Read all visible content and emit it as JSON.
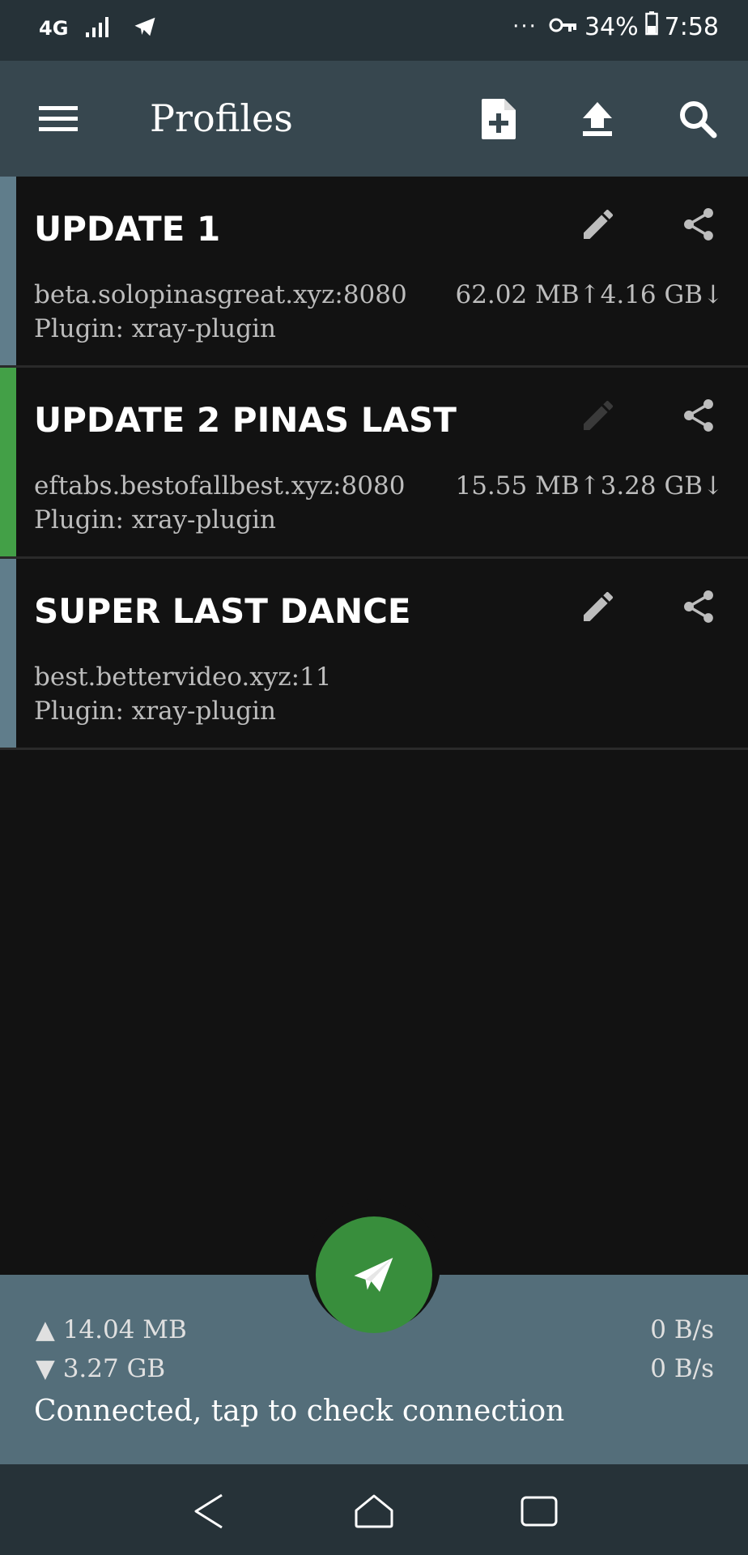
{
  "status_bar": {
    "network": "4G",
    "battery": "34%",
    "time": "7:58",
    "icons": [
      "signal-icon",
      "telegram-icon",
      "vpn-key-icon",
      "battery-icon"
    ]
  },
  "app_bar": {
    "title": "Profiles",
    "actions": [
      "add-profile-icon",
      "upload-icon",
      "search-icon"
    ]
  },
  "profiles": [
    {
      "name": "UPDATE 1",
      "host": "beta.solopinasgreat.xyz:8080",
      "plugin": "Plugin: xray-plugin",
      "upload": "62.02 MB",
      "download": "4.16 GB",
      "selected": false,
      "edit_enabled": true
    },
    {
      "name": "UPDATE 2 PINAS LAST",
      "host": "eftabs.bestofallbest.xyz:8080",
      "plugin": "Plugin: xray-plugin",
      "upload": "15.55 MB",
      "download": "3.28 GB",
      "selected": true,
      "edit_enabled": false
    },
    {
      "name": "SUPER LAST DANCE",
      "host": "best.bettervideo.xyz:11",
      "plugin": "Plugin: xray-plugin",
      "selected": false,
      "edit_enabled": true
    }
  ],
  "stats": {
    "tx_total": "▲ 14.04 MB",
    "rx_total": "▼ 3.27 GB",
    "tx_rate": "0 B/s",
    "rx_rate": "0 B/s",
    "status": "Connected, tap to check connection"
  },
  "colors": {
    "accent_selected": "#43a047",
    "accent_default": "#607d8b",
    "appbar": "#37474f",
    "bottom_panel": "#546e7a",
    "fab": "#388e3c"
  }
}
